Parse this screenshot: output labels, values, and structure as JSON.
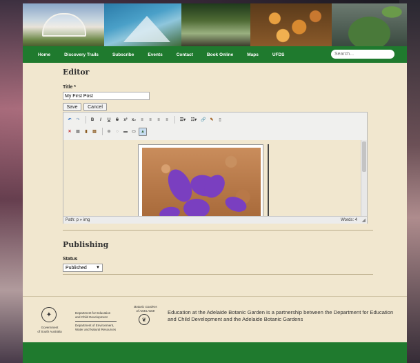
{
  "nav": {
    "items": [
      "Home",
      "Discovery Trails",
      "Subscribe",
      "Events",
      "Contact",
      "Book Online",
      "Maps",
      "UFDS"
    ],
    "search_placeholder": "Search..."
  },
  "editor": {
    "heading": "Editor",
    "title_label": "Title *",
    "title_value": "My First Post",
    "save_label": "Save",
    "cancel_label": "Cancel",
    "toolbar_row1": [
      "undo-icon",
      "redo-icon",
      "bold-icon",
      "italic-icon",
      "underline-icon",
      "strikethrough-icon",
      "superscript-icon",
      "subscript-icon",
      "align-left-icon",
      "align-center-icon",
      "align-right-icon",
      "align-justify-icon",
      "bullet-list-icon",
      "numbered-list-icon",
      "link-icon",
      "unlink-icon",
      "anchor-icon"
    ],
    "toolbar_row2": [
      "remove-format-icon",
      "paste-text-icon",
      "paste-word-icon",
      "paste-icon",
      "insert-table-icon",
      "hr-icon",
      "charmap-icon",
      "image-icon"
    ],
    "path_text": "Path: p » img",
    "words_text": "Words: 4"
  },
  "publishing": {
    "heading": "Publishing",
    "status_label": "Status",
    "status_value": "Published"
  },
  "footer": {
    "govt_sa_line1": "Government",
    "govt_sa_line2": "of South Australia",
    "dept_edu_line1": "Department for Education",
    "dept_edu_line2": "and Child Development",
    "dept_env_line1": "Department of Environment,",
    "dept_env_line2": "Water and Natural Resources",
    "bg_logo_line1": "Botanic Gardens",
    "bg_logo_line2": "of ADELAIDE",
    "text": "Education at the Adelaide Botanic Garden is a partnership between the Department for Education and Child Development and the Adelaide Botanic Gardens"
  },
  "colors": {
    "nav_green": "#1f7a2e",
    "page_bg": "#f1e7cf",
    "flower_purple": "#7a3fc0"
  }
}
